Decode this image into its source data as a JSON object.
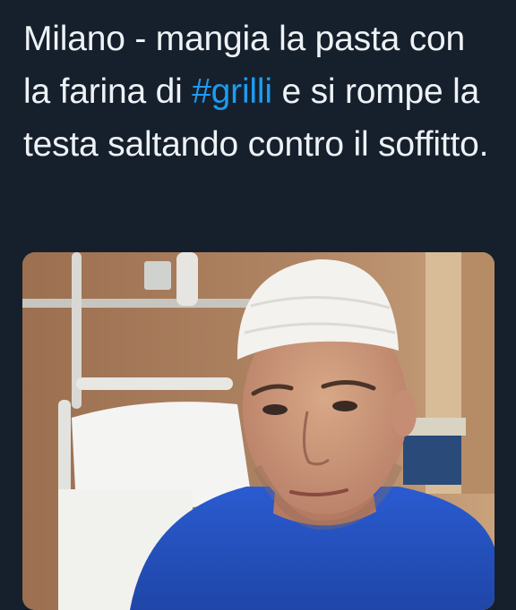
{
  "tweet": {
    "text_parts": [
      "Milano - mangia la pasta con la farina di ",
      "#grilli",
      " e si rompe la testa saltando contro il soffitto."
    ],
    "hashtag": "#grilli"
  },
  "colors": {
    "background": "#16202c",
    "text": "#eef2f6",
    "hashtag": "#1d9bf0"
  },
  "media": {
    "icons": [
      "hospital-bed-icon",
      "bandaged-head-icon"
    ]
  }
}
